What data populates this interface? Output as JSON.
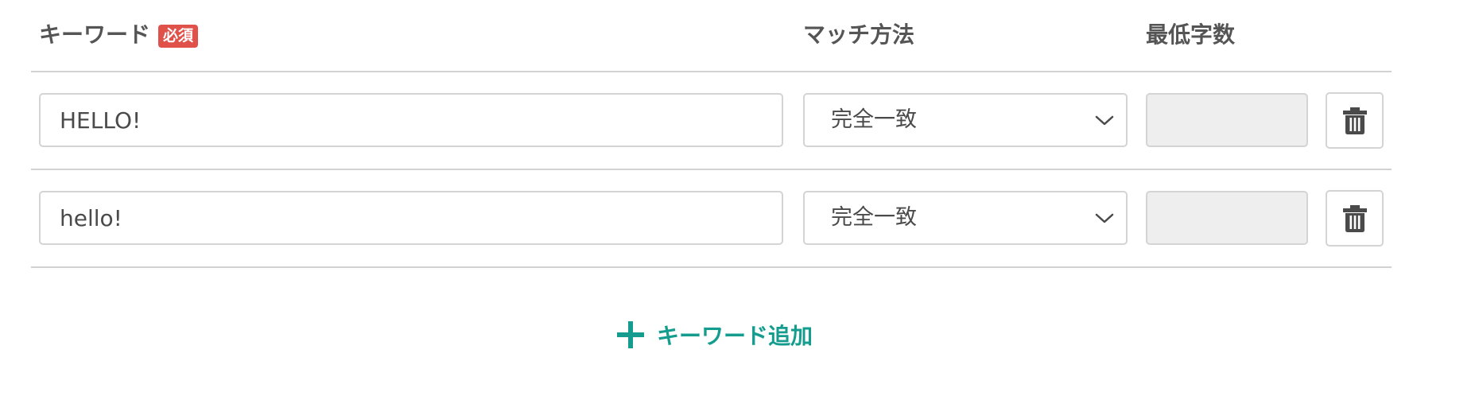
{
  "header": {
    "keyword_label": "キーワード",
    "required_badge": "必須",
    "match_label": "マッチ方法",
    "min_chars_label": "最低字数"
  },
  "rows": [
    {
      "keyword_value": "HELLO!",
      "match_value": "完全一致",
      "min_chars_value": ""
    },
    {
      "keyword_value": "hello!",
      "match_value": "完全一致",
      "min_chars_value": ""
    }
  ],
  "add_button": {
    "label": "キーワード追加"
  },
  "icons": {
    "chevron": "chevron-down-icon",
    "delete": "trash-icon",
    "add": "plus-icon"
  },
  "colors": {
    "required_badge_bg": "#e0514a",
    "accent_teal": "#149c8f",
    "disabled_field_bg": "#eeeeee",
    "border": "#d4d4d4"
  }
}
